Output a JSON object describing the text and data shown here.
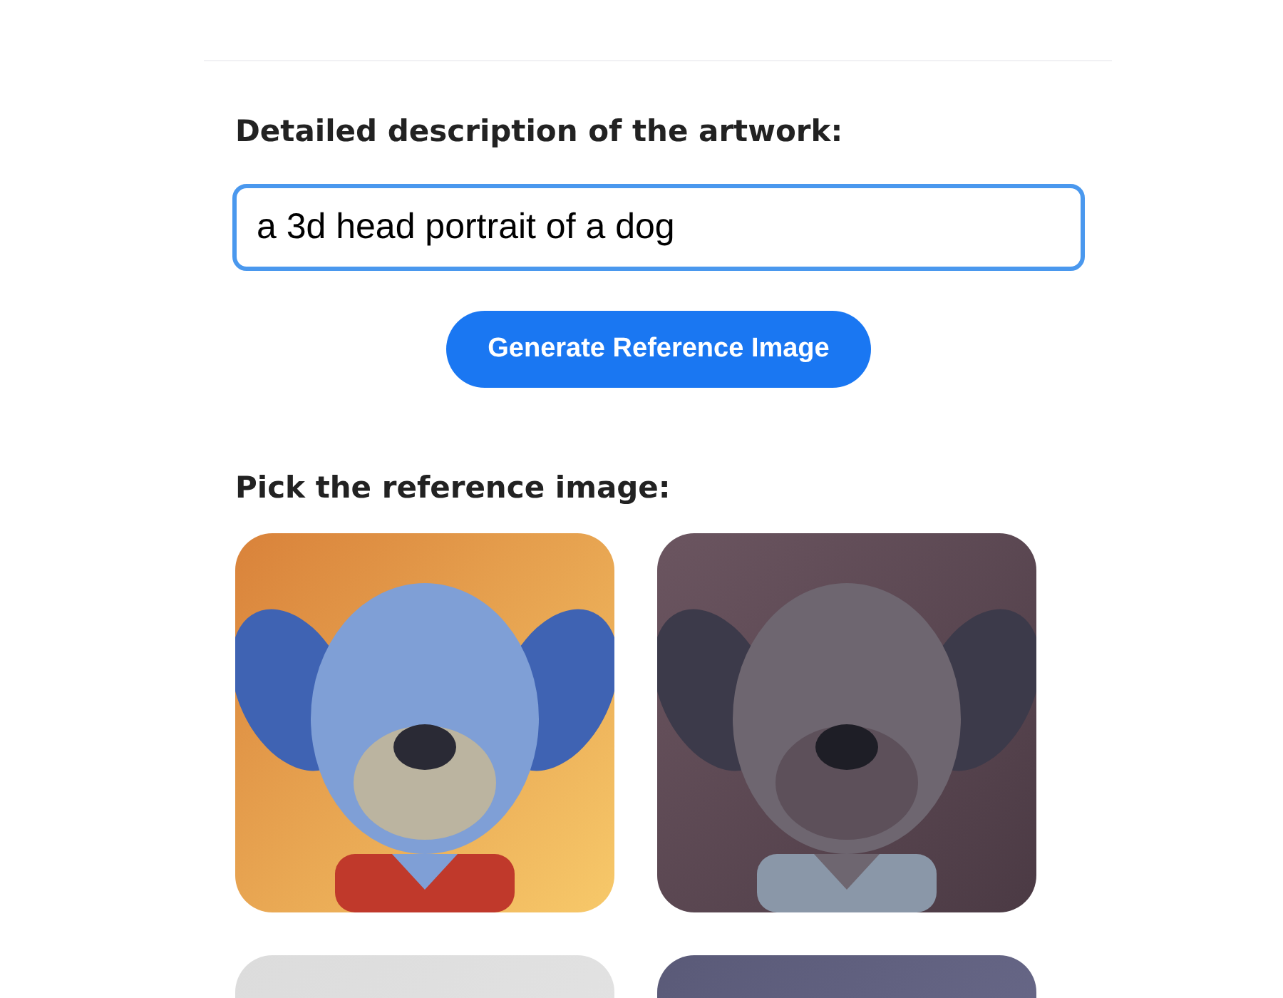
{
  "description_label": "Detailed description of the artwork:",
  "description_field": {
    "value": "a 3d head portrait of a dog"
  },
  "generate_button": "Generate Reference Image",
  "pick_label": "Pick the reference image:"
}
